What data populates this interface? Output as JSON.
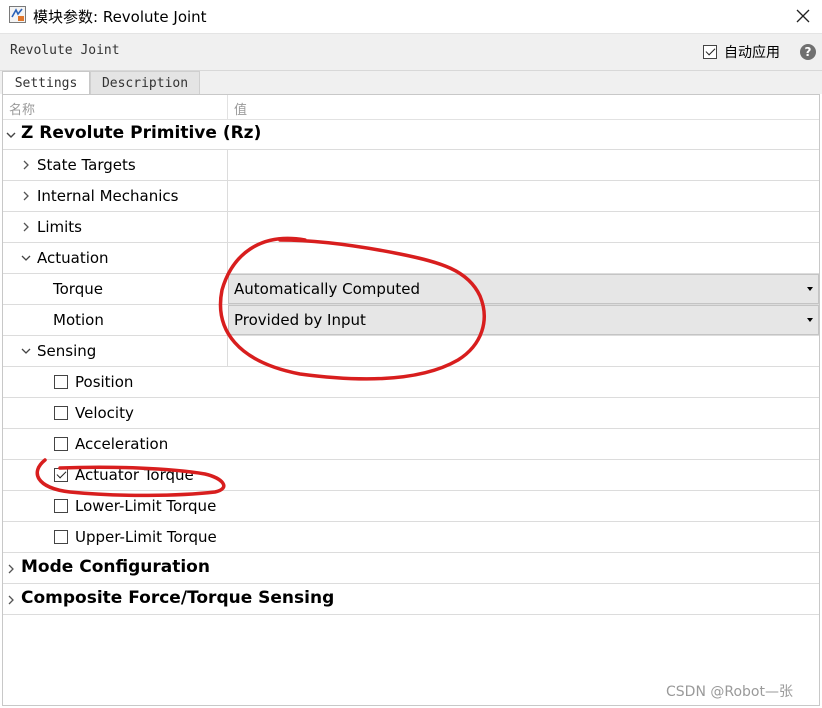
{
  "window": {
    "title": "模块参数: Revolute Joint",
    "block_name": "Revolute Joint",
    "auto_apply_label": "自动应用",
    "auto_apply_checked": true,
    "help_symbol": "?",
    "close_icon": "close-icon"
  },
  "tabs": [
    {
      "label": "Settings",
      "active": true
    },
    {
      "label": "Description",
      "active": false
    }
  ],
  "columns": {
    "name": "名称",
    "value": "值"
  },
  "tree": {
    "primitive": "Z Revolute Primitive (Rz)",
    "state_targets": "State Targets",
    "internal_mechanics": "Internal Mechanics",
    "limits": "Limits",
    "actuation": {
      "label": "Actuation",
      "torque_label": "Torque",
      "torque_value": "Automatically Computed",
      "motion_label": "Motion",
      "motion_value": "Provided by Input"
    },
    "sensing": {
      "label": "Sensing",
      "items": [
        {
          "label": "Position",
          "checked": false
        },
        {
          "label": "Velocity",
          "checked": false
        },
        {
          "label": "Acceleration",
          "checked": false
        },
        {
          "label": "Actuator Torque",
          "checked": true
        },
        {
          "label": "Lower-Limit Torque",
          "checked": false
        },
        {
          "label": "Upper-Limit Torque",
          "checked": false
        }
      ]
    },
    "mode_configuration": "Mode Configuration",
    "composite_sensing": "Composite Force/Torque Sensing"
  },
  "watermark": "CSDN @Robot—张",
  "colors": {
    "annotation": "#d81e1e",
    "combo_bg": "#e6e6e6",
    "toolbar_bg": "#f0f0f0"
  }
}
